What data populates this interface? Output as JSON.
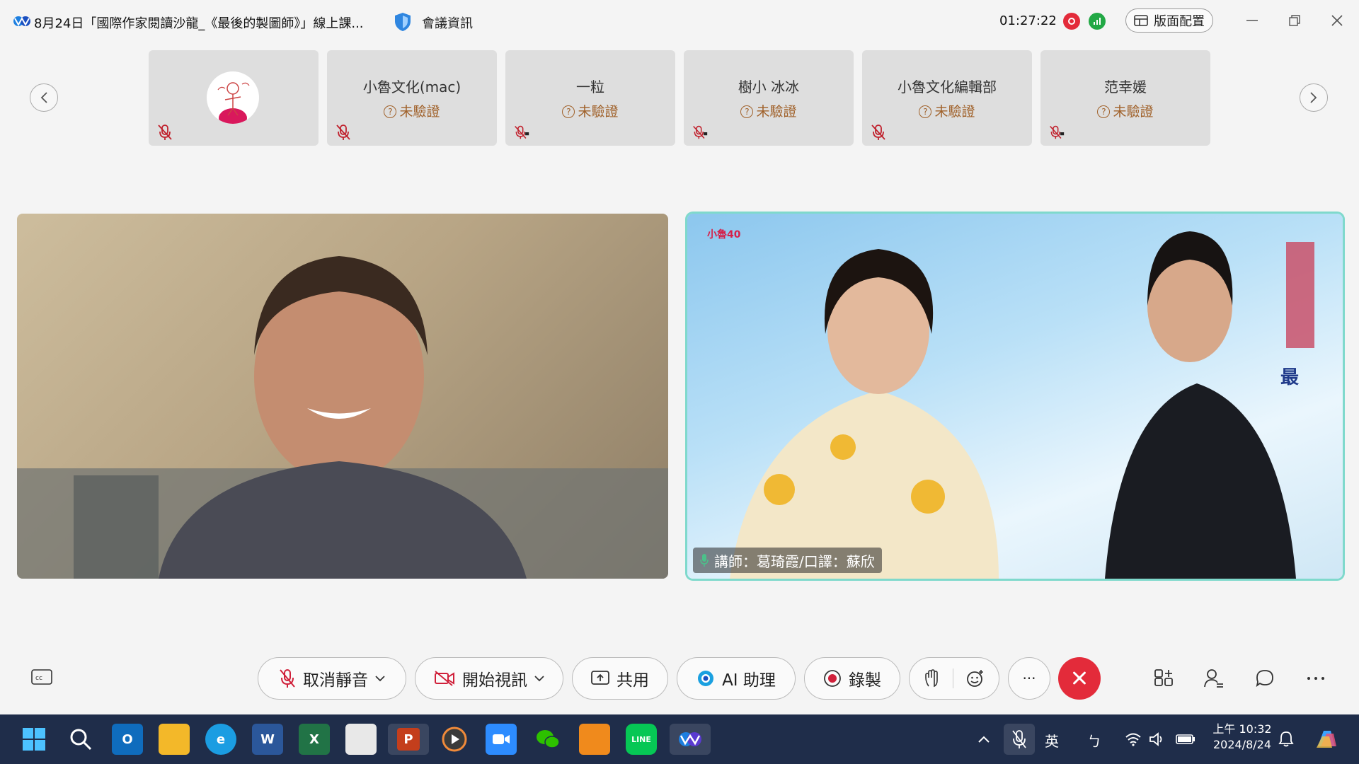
{
  "window": {
    "title": "8月24日「國際作家閱讀沙龍_《最後的製圖師》」線上課...",
    "meeting_info_label": "會議資訊",
    "timer": "01:27:22",
    "layout_button": "版面配置"
  },
  "participants": [
    {
      "name": "",
      "verify": "",
      "has_avatar": true
    },
    {
      "name": "小魯文化(mac)",
      "verify": "未驗證"
    },
    {
      "name": "一粒",
      "verify": "未驗證"
    },
    {
      "name": "樹小 冰冰",
      "verify": "未驗證"
    },
    {
      "name": "小魯文化編輯部",
      "verify": "未驗證"
    },
    {
      "name": "范幸媛",
      "verify": "未驗證"
    }
  ],
  "videos": {
    "right_caption": "講師：葛琦霞/口譯：蘇欣",
    "right_logo_text": "小魯40",
    "right_book_text": "最"
  },
  "controls": {
    "unmute": "取消靜音",
    "start_video": "開始視訊",
    "share": "共用",
    "ai_assistant": "AI 助理",
    "record": "錄製",
    "more": "···"
  },
  "taskbar": {
    "ime_lang": "英",
    "ime_mode": "ㄅ",
    "time": "上午 10:32",
    "date": "2024/8/24"
  },
  "colors": {
    "record_red": "#e32b3a",
    "signal_green": "#22a845",
    "verify_brown": "#a0612a",
    "active_speaker_border": "#7fd9cc",
    "taskbar_bg": "#1f2d4a"
  }
}
